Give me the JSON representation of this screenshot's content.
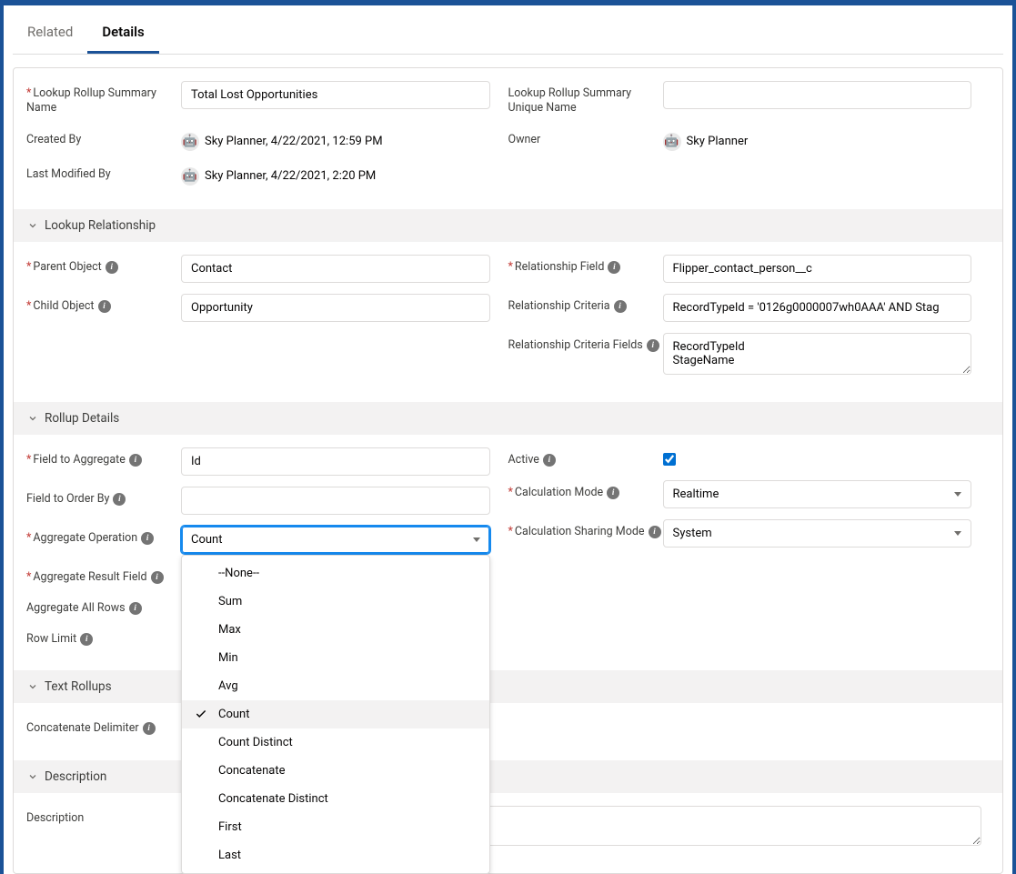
{
  "tabs": {
    "related": "Related",
    "details": "Details"
  },
  "top": {
    "summary_name_label": "Lookup Rollup Summary Name",
    "summary_name_value": "Total Lost Opportunities",
    "unique_name_label": "Lookup Rollup Summary Unique Name",
    "unique_name_value": "",
    "created_by_label": "Created By",
    "created_by_value": "Sky Planner, 4/22/2021, 12:59 PM",
    "owner_label": "Owner",
    "owner_value": "Sky Planner",
    "modified_by_label": "Last Modified By",
    "modified_by_value": "Sky Planner, 4/22/2021, 2:20 PM"
  },
  "lookup_section": {
    "title": "Lookup Relationship",
    "parent_object_label": "Parent Object",
    "parent_object_value": "Contact",
    "child_object_label": "Child Object",
    "child_object_value": "Opportunity",
    "relationship_field_label": "Relationship Field",
    "relationship_field_value": "Flipper_contact_person__c",
    "relationship_criteria_label": "Relationship Criteria",
    "relationship_criteria_value": "RecordTypeId = '0126g0000007wh0AAA' AND Stag",
    "relationship_criteria_fields_label": "Relationship Criteria Fields",
    "relationship_criteria_fields_value": "RecordTypeId\nStageName"
  },
  "rollup_section": {
    "title": "Rollup Details",
    "field_to_aggregate_label": "Field to Aggregate",
    "field_to_aggregate_value": "Id",
    "field_to_order_label": "Field to Order By",
    "field_to_order_value": "",
    "aggregate_operation_label": "Aggregate Operation",
    "aggregate_operation_value": "Count",
    "aggregate_result_field_label": "Aggregate Result Field",
    "aggregate_all_rows_label": "Aggregate All Rows",
    "row_limit_label": "Row Limit",
    "active_label": "Active",
    "active_checked": true,
    "calculation_mode_label": "Calculation Mode",
    "calculation_mode_value": "Realtime",
    "calculation_sharing_label": "Calculation Sharing Mode",
    "calculation_sharing_value": "System",
    "dropdown_options": [
      "--None--",
      "Sum",
      "Max",
      "Min",
      "Avg",
      "Count",
      "Count Distinct",
      "Concatenate",
      "Concatenate Distinct",
      "First",
      "Last"
    ]
  },
  "text_section": {
    "title": "Text Rollups",
    "concatenate_delimiter_label": "Concatenate Delimiter"
  },
  "description_section": {
    "title": "Description",
    "description_label": "Description",
    "description_value": ""
  }
}
